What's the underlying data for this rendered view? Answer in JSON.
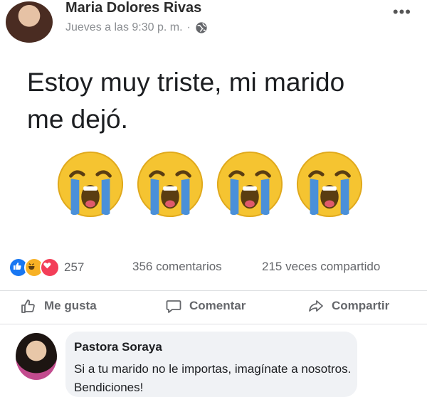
{
  "post": {
    "author": "Maria Dolores Rivas",
    "timestamp": "Jueves a las 9:30 p. m.",
    "privacy_dot": "·",
    "privacy_icon": "globe-icon",
    "more_label": "•••",
    "text_lines": [
      "Estoy muy triste, mi marido",
      "me dejó."
    ],
    "emoji_icon": "loudly-crying-face-icon",
    "emoji_count": 4
  },
  "stats": {
    "reaction_icons": [
      "like-icon",
      "haha-icon",
      "love-icon"
    ],
    "reactions": "257",
    "comments": "356 comentarios",
    "shares": "215 veces compartido"
  },
  "actions": {
    "like_label": "Me gusta",
    "comment_label": "Comentar",
    "share_label": "Compartir"
  },
  "comment": {
    "author": "Pastora Soraya",
    "text": "Si a tu marido no le importas, imagínate a nosotros. Bendiciones!"
  },
  "colors": {
    "text": "#1c1e21",
    "muted": "#65676b",
    "like_blue": "#1877f2",
    "bubble": "#f0f2f5"
  }
}
